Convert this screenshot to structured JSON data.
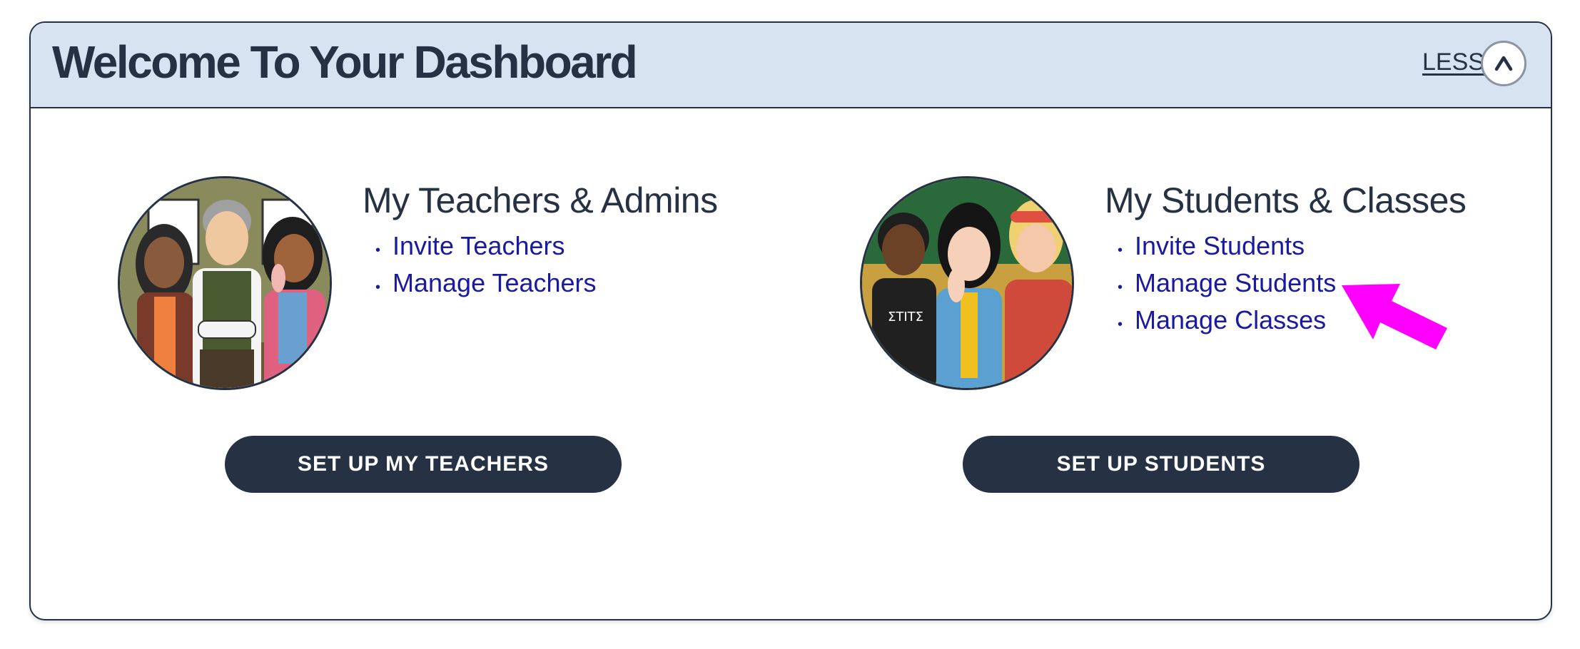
{
  "header": {
    "title": "Welcome To Your Dashboard",
    "less_label": "LESS",
    "collapse_icon": "chevron-up-icon"
  },
  "teachers_section": {
    "heading": "My Teachers & Admins",
    "image_alt": "teachers-and-admins-illustration",
    "links": [
      "Invite Teachers",
      "Manage Teachers"
    ],
    "button_label": "SET UP MY TEACHERS"
  },
  "students_section": {
    "heading": "My Students & Classes",
    "image_alt": "students-illustration",
    "links": [
      "Invite Students",
      "Manage Students",
      "Manage Classes"
    ],
    "button_label": "SET UP STUDENTS"
  },
  "annotation": {
    "icon": "pointer-arrow-icon",
    "color": "#ff00ff"
  },
  "colors": {
    "navy": "#263244",
    "header_bg": "#d8e3f1",
    "link": "#1a1a9e"
  }
}
